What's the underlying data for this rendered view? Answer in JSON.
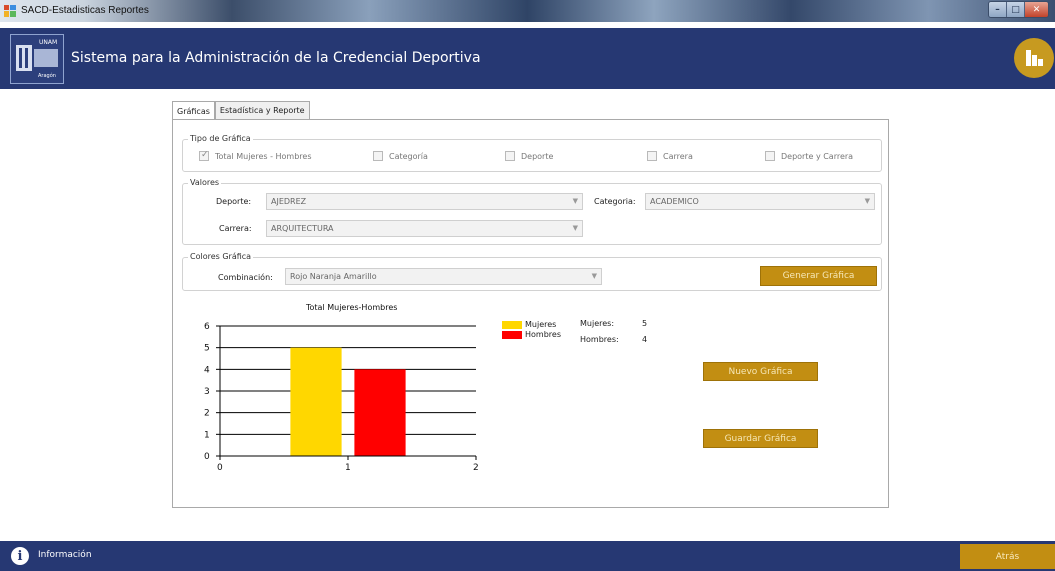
{
  "window": {
    "title": "SACD-Estadisticas Reportes",
    "controls": [
      "minimize",
      "maximize",
      "close"
    ]
  },
  "header": {
    "app_title": "Sistema para la Administración de la Credencial Deportiva",
    "logo_text": [
      "UNAM",
      "Aragón"
    ],
    "icon": "bar-chart-icon"
  },
  "tabs": [
    {
      "label": "Gráficas",
      "active": true
    },
    {
      "label": "Estadística y Reporte",
      "active": false
    }
  ],
  "tipo": {
    "title": "Tipo de Gráfica",
    "options": [
      {
        "label": "Total Mujeres - Hombres",
        "checked": true
      },
      {
        "label": "Categoría",
        "checked": false
      },
      {
        "label": "Deporte",
        "checked": false
      },
      {
        "label": "Carrera",
        "checked": false
      },
      {
        "label": "Deporte y Carrera",
        "checked": false
      }
    ]
  },
  "valores": {
    "title": "Valores",
    "deporte_label": "Deporte:",
    "deporte_value": "AJEDREZ",
    "categoria_label": "Categoria:",
    "categoria_value": "ACADEMICO",
    "carrera_label": "Carrera:",
    "carrera_value": "ARQUITECTURA"
  },
  "colores": {
    "title": "Colores Gráfica",
    "combinacion_label": "Combinación:",
    "combinacion_value": "Rojo Naranja Amarillo",
    "generate_label": "Generar Gráfica"
  },
  "chart_data": {
    "type": "bar",
    "title": "Total Mujeres-Hombres",
    "series": [
      {
        "name": "Mujeres",
        "x": 0.75,
        "value": 5,
        "color": "#ffd700"
      },
      {
        "name": "Hombres",
        "x": 1.25,
        "value": 4,
        "color": "#ff0000"
      }
    ],
    "x_ticks": [
      "0",
      "1",
      "2"
    ],
    "xlim": [
      0,
      2
    ],
    "y_ticks": [
      "0",
      "1",
      "2",
      "3",
      "4",
      "5",
      "6"
    ],
    "ylim": [
      0,
      6
    ],
    "grid": true,
    "legend": "top-right"
  },
  "counts": {
    "mujeres_label": "Mujeres:",
    "mujeres_value": "5",
    "hombres_label": "Hombres:",
    "hombres_value": "4"
  },
  "actions": {
    "nuevo_label": "Nuevo Gráfica",
    "guardar_label": "Guardar Gráfica"
  },
  "footer": {
    "info_label": "Información",
    "back_label": "Atrás"
  },
  "colors": {
    "navy": "#263873",
    "gold": "#c28e12"
  }
}
